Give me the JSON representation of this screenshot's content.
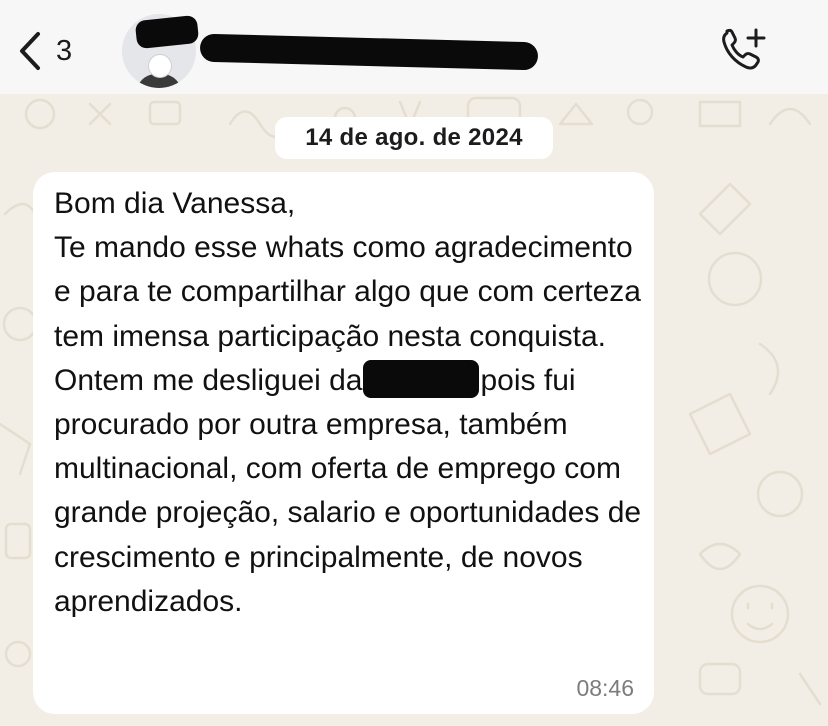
{
  "header": {
    "back_count": "3",
    "contact_name": "[redacted]",
    "call_icon": "phone-plus-icon",
    "back_icon": "chevron-left-icon"
  },
  "chat": {
    "date_chip": "14 de ago. de 2024",
    "message": {
      "text_before_redaction": "Bom dia Vanessa,\nTe mando esse whats como agradecimento e para te compartilhar algo que com certeza tem imensa participação nesta conquista.\nOntem me desliguei da",
      "text_after_redaction": "pois fui procurado por outra empresa, também multinacional, com oferta de emprego com grande projeção, salario e oportunidades de crescimento e principalmente, de novos aprendizados.",
      "time": "08:46"
    }
  },
  "colors": {
    "header_bg": "#f7f7f7",
    "chat_bg": "#f3eee5",
    "bubble_bg": "#ffffff",
    "redaction": "#0a0a0a"
  }
}
